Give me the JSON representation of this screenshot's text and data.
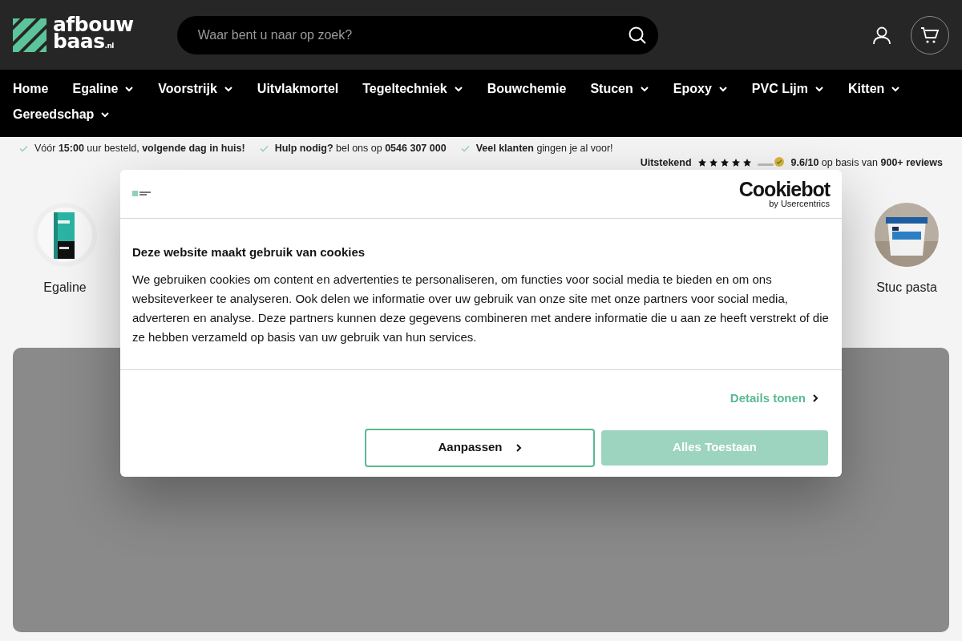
{
  "header": {
    "logo": {
      "line_1": "afbouw",
      "line_2": "baas",
      "suffix": ".nl"
    },
    "search": {
      "placeholder": "Waar bent u naar op zoek?"
    }
  },
  "nav": [
    {
      "label": "Home",
      "dropdown": false
    },
    {
      "label": "Egaline",
      "dropdown": true
    },
    {
      "label": "Voorstrijk",
      "dropdown": true
    },
    {
      "label": "Uitvlakmortel",
      "dropdown": false
    },
    {
      "label": "Tegeltechniek",
      "dropdown": true
    },
    {
      "label": "Bouwchemie",
      "dropdown": false
    },
    {
      "label": "Stucen",
      "dropdown": true
    },
    {
      "label": "Epoxy",
      "dropdown": true
    },
    {
      "label": "PVC Lijm",
      "dropdown": true
    },
    {
      "label": "Kitten",
      "dropdown": true
    },
    {
      "label": "Gereedschap",
      "dropdown": true
    }
  ],
  "usps": [
    "Vóór **15:00** uur besteld, **volgende dag in huis!**",
    "**Hulp nodig?** bel ons op **0546 307 000**",
    "**Veel klanten** gingen je al voor!"
  ],
  "rating": {
    "label": "Uitstekend",
    "stars": 5,
    "summary": "**9.6/10** op basis van **900+ reviews**"
  },
  "categories": [
    {
      "label": "Egaline",
      "kind": "bag"
    },
    {
      "label": "Stuc pasta",
      "kind": "bucket"
    }
  ],
  "cookie_dialog": {
    "brand": "Cookiebot",
    "brand_sub": "by Usercentrics",
    "title": "Deze website maakt gebruik van cookies",
    "body": "We gebruiken cookies om content en advertenties te personaliseren, om functies voor social media te bieden en om ons websiteverkeer te analyseren. Ook delen we informatie over uw gebruik van onze site met onze partners voor social media, adverteren en analyse. Deze partners kunnen deze gegevens combineren met andere informatie die u aan ze heeft verstrekt of die ze hebben verzameld op basis van uw gebruik van hun services.",
    "details_link": "Details tonen",
    "buttons": [
      {
        "label": "Aanpassen",
        "kind": "outline"
      },
      {
        "label": "Alles Toestaan",
        "kind": "primary"
      }
    ]
  }
}
